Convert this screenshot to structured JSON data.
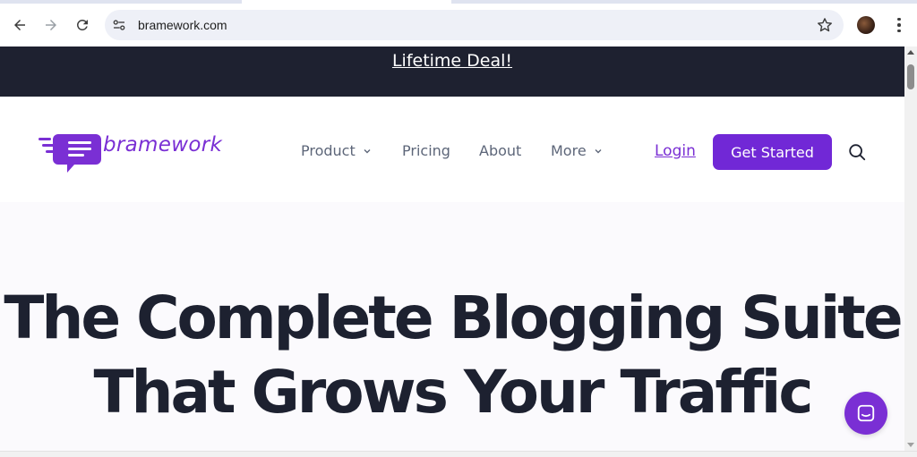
{
  "browser": {
    "url": "bramework.com",
    "icons": {
      "back": "arrow-left-icon",
      "forward": "arrow-right-icon",
      "reload": "reload-icon",
      "site_info": "tune-icon",
      "bookmark": "star-icon",
      "menu": "kebab-icon"
    }
  },
  "promo": {
    "link_text": "Lifetime Deal!"
  },
  "header": {
    "brand": "bramework",
    "nav": {
      "product": "Product",
      "pricing": "Pricing",
      "about": "About",
      "more": "More"
    },
    "login": "Login",
    "cta": "Get Started"
  },
  "hero": {
    "title_line1": "The Complete Blogging Suite",
    "title_line2": "That Grows Your Traffic"
  },
  "colors": {
    "brand_purple": "#7128d6",
    "promo_bg": "#1e2130",
    "heading": "#1d2130",
    "nav_text": "#5d6679"
  }
}
